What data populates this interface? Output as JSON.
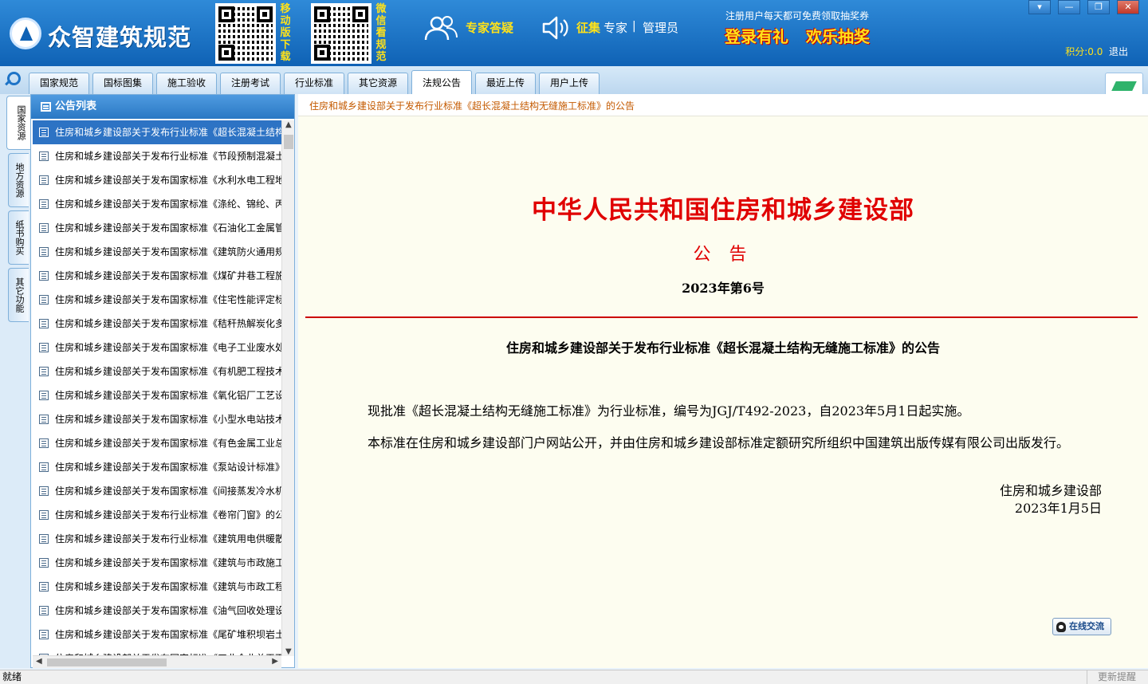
{
  "header": {
    "logo_text": "众智建筑规范",
    "qr1_label": "移动版下载",
    "qr2_label": "微信看规范",
    "expert_qa": "专家答疑",
    "recruit": "征集",
    "expert": "专家",
    "sep": "|",
    "admin": "管理员",
    "promo_small": "注册用户每天都可免费领取抽奖券",
    "promo_big1": "登录有礼",
    "promo_big2": "欢乐抽奖",
    "points_label": "积分:",
    "points_value": "0.0",
    "logout": "退出",
    "window_buttons": [
      "▾",
      "—",
      "❐",
      "✕"
    ]
  },
  "tabs": [
    {
      "label": "国家规范"
    },
    {
      "label": "国标图集"
    },
    {
      "label": "施工验收"
    },
    {
      "label": "注册考试"
    },
    {
      "label": "行业标准"
    },
    {
      "label": "其它资源"
    },
    {
      "label": "法规公告",
      "active": true
    },
    {
      "label": "最近上传"
    },
    {
      "label": "用户上传"
    }
  ],
  "side_tabs": [
    {
      "label": "国家资源",
      "active": true
    },
    {
      "label": "地方资源"
    },
    {
      "label": "纸书购买"
    },
    {
      "label": "其它功能"
    }
  ],
  "list": {
    "title": "公告列表",
    "items": [
      "住房和城乡建设部关于发布行业标准《超长混凝土结构无缝施工标准》的公告",
      "住房和城乡建设部关于发布行业标准《节段预制混凝土",
      "住房和城乡建设部关于发布国家标准《水利水电工程地",
      "住房和城乡建设部关于发布国家标准《涤纶、锦纶、丙",
      "住房和城乡建设部关于发布国家标准《石油化工金属管",
      "住房和城乡建设部关于发布国家标准《建筑防火通用规",
      "住房和城乡建设部关于发布国家标准《煤矿井巷工程施",
      "住房和城乡建设部关于发布国家标准《住宅性能评定标",
      "住房和城乡建设部关于发布国家标准《秸秆热解炭化多",
      "住房和城乡建设部关于发布国家标准《电子工业废水处",
      "住房和城乡建设部关于发布国家标准《有机肥工程技术",
      "住房和城乡建设部关于发布国家标准《氧化铝厂工艺设",
      "住房和城乡建设部关于发布国家标准《小型水电站技术",
      "住房和城乡建设部关于发布国家标准《有色金属工业总",
      "住房和城乡建设部关于发布国家标准《泵站设计标准》",
      "住房和城乡建设部关于发布国家标准《间接蒸发冷水机",
      "住房和城乡建设部关于发布行业标准《卷帘门窗》的公",
      "住房和城乡建设部关于发布行业标准《建筑用电供暖散",
      "住房和城乡建设部关于发布国家标准《建筑与市政施工",
      "住房和城乡建设部关于发布国家标准《建筑与市政工程",
      "住房和城乡建设部关于发布国家标准《油气回收处理设",
      "住房和城乡建设部关于发布国家标准《尾矿堆积坝岩土",
      "住房和城乡建设部关于发布国家标准《工业企业总平面"
    ]
  },
  "content": {
    "breadcrumb": "住房和城乡建设部关于发布行业标准《超长混凝土结构无缝施工标准》的公告",
    "org_title": "中华人民共和国住房和城乡建设部",
    "doc_type": "公 告",
    "doc_number": "2023年第6号",
    "heading": "住房和城乡建设部关于发布行业标准《超长混凝土结构无缝施工标准》的公告",
    "para1": "现批准《超长混凝土结构无缝施工标准》为行业标准，编号为JGJ/T492-2023，自2023年5月1日起实施。",
    "para2": "本标准在住房和城乡建设部门户网站公开，并由住房和城乡建设部标准定额研究所组织中国建筑出版传媒有限公司出版发行。",
    "signer": "住房和城乡建设部",
    "date": "2023年1月5日",
    "chat_button": "在线交流"
  },
  "status": {
    "left": "就绪",
    "right": "更新提醒"
  },
  "colors": {
    "accent": "#1e74c7",
    "title_red": "#e00000",
    "promo_yellow": "#ffe21a"
  }
}
